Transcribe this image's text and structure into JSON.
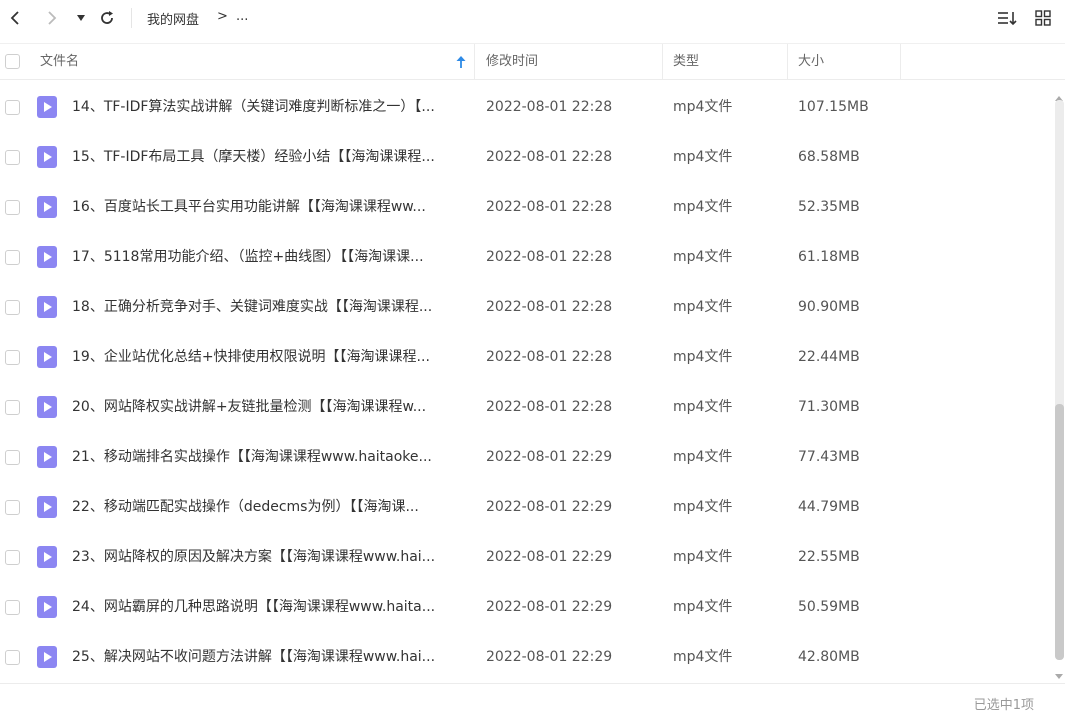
{
  "toolbar": {
    "back_icon": "chevron-left-icon",
    "forward_icon": "chevron-right-icon",
    "dropdown_icon": "caret-down-icon",
    "refresh_icon": "refresh-icon",
    "sort_icon": "sort-list-icon",
    "grid_icon": "grid-view-icon"
  },
  "breadcrumb": {
    "root": "我的网盘",
    "separator": ">",
    "more": "..."
  },
  "table": {
    "headers": {
      "name": "文件名",
      "time": "修改时间",
      "type": "类型",
      "size": "大小"
    },
    "sort_indicator": "arrow-up-icon",
    "rows": [
      {
        "name": "14、TF-IDF算法实战讲解（关键词难度判断标准之一）【...",
        "time": "2022-08-01 22:28",
        "type": "mp4文件",
        "size": "107.15MB"
      },
      {
        "name": "15、TF-IDF布局工具（摩天楼）经验小结【【海淘课课程...",
        "time": "2022-08-01 22:28",
        "type": "mp4文件",
        "size": "68.58MB"
      },
      {
        "name": "16、百度站长工具平台实用功能讲解【【海淘课课程ww...",
        "time": "2022-08-01 22:28",
        "type": "mp4文件",
        "size": "52.35MB"
      },
      {
        "name": "17、5118常用功能介绍、（监控+曲线图）【【海淘课课...",
        "time": "2022-08-01 22:28",
        "type": "mp4文件",
        "size": "61.18MB"
      },
      {
        "name": "18、正确分析竞争对手、关键词难度实战【【海淘课课程...",
        "time": "2022-08-01 22:28",
        "type": "mp4文件",
        "size": "90.90MB"
      },
      {
        "name": "19、企业站优化总结+快排使用权限说明【【海淘课课程...",
        "time": "2022-08-01 22:28",
        "type": "mp4文件",
        "size": "22.44MB"
      },
      {
        "name": "20、网站降权实战讲解+友链批量检测【【海淘课课程w...",
        "time": "2022-08-01 22:28",
        "type": "mp4文件",
        "size": "71.30MB"
      },
      {
        "name": "21、移动端排名实战操作【【海淘课课程www.haitaoke...",
        "time": "2022-08-01 22:29",
        "type": "mp4文件",
        "size": "77.43MB"
      },
      {
        "name": "22、移动端匹配实战操作（dedecms为例）【【海淘课...",
        "time": "2022-08-01 22:29",
        "type": "mp4文件",
        "size": "44.79MB"
      },
      {
        "name": "23、网站降权的原因及解决方案【【海淘课课程www.hai...",
        "time": "2022-08-01 22:29",
        "type": "mp4文件",
        "size": "22.55MB"
      },
      {
        "name": "24、网站霸屏的几种思路说明【【海淘课课程www.haita...",
        "time": "2022-08-01 22:29",
        "type": "mp4文件",
        "size": "50.59MB"
      },
      {
        "name": "25、解决网站不收问题方法讲解【【海淘课课程www.hai...",
        "time": "2022-08-01 22:29",
        "type": "mp4文件",
        "size": "42.80MB"
      }
    ]
  },
  "status": {
    "selected": "已选中1项"
  },
  "colors": {
    "file_icon": "#8c86f2",
    "sort_arrow": "#2e8ae6",
    "scroll_thumb": "#c9c9c9"
  }
}
